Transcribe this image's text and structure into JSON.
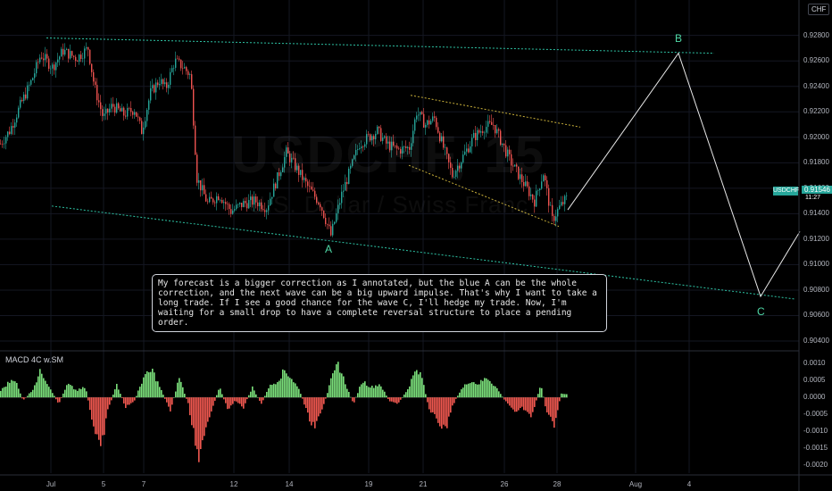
{
  "currency": "CHF",
  "symbol": "USDCHF",
  "watermark": {
    "title": "USDCHF, 15",
    "subtitle": "U.S. Dollar / Swiss Franc"
  },
  "annotation": "My forecast is a bigger correction as I annotated, but the blue A can be the whole correction, and the next wave can be a big upward impulse. That's why I want to take a long trade. If I see a good chance for the wave C, I'll hedge my trade. Now, I'm waiting for a small drop to have a complete reversal structure to place a pending order.",
  "wave_labels": {
    "a": "A",
    "b": "B",
    "c": "C"
  },
  "current_price": {
    "value": "0.91546",
    "time": "11:27",
    "symbol": "USDCHF"
  },
  "macd_label": "MACD 4C w.SM",
  "colors": {
    "up": "#26a69a",
    "down": "#ef5350",
    "hist_up": "#7be07b",
    "hist_down": "#f0584f",
    "teal_line": "#2ec4a5",
    "yellow_line": "#c9b03a",
    "projection": "#e8e8e8"
  },
  "chart_data": [
    {
      "type": "candlestick",
      "y_ticks": [
        "0.92800",
        "0.92600",
        "0.92400",
        "0.92200",
        "0.92000",
        "0.91800",
        "0.91600",
        "0.91400",
        "0.91200",
        "0.91000",
        "0.90800",
        "0.90600",
        "0.90400"
      ],
      "ylim": [
        0.9033,
        0.9298
      ],
      "x_ticks": [
        "Jul",
        "5",
        "7",
        "12",
        "14",
        "19",
        "21",
        "26",
        "28",
        "Aug",
        "4"
      ],
      "price_path": [
        [
          0,
          0.9195
        ],
        [
          10,
          0.9205
        ],
        [
          22,
          0.9225
        ],
        [
          35,
          0.9245
        ],
        [
          45,
          0.9265
        ],
        [
          58,
          0.9255
        ],
        [
          70,
          0.9268
        ],
        [
          85,
          0.9262
        ],
        [
          98,
          0.927
        ],
        [
          105,
          0.924
        ],
        [
          115,
          0.9215
        ],
        [
          125,
          0.9225
        ],
        [
          138,
          0.9218
        ],
        [
          150,
          0.9222
        ],
        [
          158,
          0.9205
        ],
        [
          168,
          0.9235
        ],
        [
          178,
          0.9245
        ],
        [
          185,
          0.9238
        ],
        [
          195,
          0.926
        ],
        [
          205,
          0.9255
        ],
        [
          213,
          0.9248
        ],
        [
          220,
          0.9168
        ],
        [
          232,
          0.9148
        ],
        [
          245,
          0.9155
        ],
        [
          258,
          0.9142
        ],
        [
          272,
          0.9148
        ],
        [
          285,
          0.915
        ],
        [
          298,
          0.9145
        ],
        [
          310,
          0.9168
        ],
        [
          320,
          0.9188
        ],
        [
          332,
          0.9175
        ],
        [
          345,
          0.916
        ],
        [
          358,
          0.9148
        ],
        [
          370,
          0.9123
        ],
        [
          382,
          0.9155
        ],
        [
          392,
          0.9175
        ],
        [
          402,
          0.9195
        ],
        [
          412,
          0.92
        ],
        [
          422,
          0.9205
        ],
        [
          432,
          0.9195
        ],
        [
          445,
          0.919
        ],
        [
          458,
          0.9192
        ],
        [
          466,
          0.922
        ],
        [
          476,
          0.921
        ],
        [
          486,
          0.9215
        ],
        [
          496,
          0.9192
        ],
        [
          506,
          0.917
        ],
        [
          518,
          0.9185
        ],
        [
          530,
          0.92
        ],
        [
          542,
          0.9208
        ],
        [
          552,
          0.921
        ],
        [
          562,
          0.9195
        ],
        [
          572,
          0.918
        ],
        [
          585,
          0.9165
        ],
        [
          598,
          0.915
        ],
        [
          608,
          0.9172
        ],
        [
          618,
          0.9135
        ],
        [
          626,
          0.9145
        ],
        [
          634,
          0.9152
        ]
      ],
      "channel_upper": [
        [
          52,
          0.9278
        ],
        [
          800,
          0.9266
        ]
      ],
      "channel_lower": [
        [
          58,
          0.9146
        ],
        [
          890,
          0.9073
        ]
      ],
      "yellow_upper": [
        [
          460,
          0.9233
        ],
        [
          650,
          0.9208
        ]
      ],
      "yellow_lower": [
        [
          458,
          0.9178
        ],
        [
          626,
          0.913
        ]
      ],
      "projection": [
        [
          636,
          0.9143
        ],
        [
          760,
          0.9266
        ],
        [
          852,
          0.9075
        ],
        [
          896,
          0.9126
        ]
      ],
      "wave_points": {
        "A": [
          368,
          0.9112
        ],
        "B": [
          760,
          0.9278
        ],
        "C": [
          852,
          0.9063
        ]
      }
    },
    {
      "type": "bar",
      "name": "MACD 4C w.SM",
      "y_ticks": [
        "0.0010",
        "0.0005",
        "0.0000",
        "-0.0005",
        "-0.0010",
        "-0.0015",
        "-0.0020"
      ],
      "ylim": [
        -0.00225,
        0.00125
      ],
      "histogram": [
        [
          0,
          0.0002
        ],
        [
          15,
          0.0006
        ],
        [
          25,
          -0.0001
        ],
        [
          35,
          0.0002
        ],
        [
          45,
          0.0008
        ],
        [
          55,
          0.0003
        ],
        [
          65,
          -0.0002
        ],
        [
          75,
          0.0004
        ],
        [
          85,
          0.0002
        ],
        [
          95,
          0.0003
        ],
        [
          105,
          -0.001
        ],
        [
          112,
          -0.0016
        ],
        [
          120,
          -0.0004
        ],
        [
          130,
          0.0004
        ],
        [
          140,
          -0.0003
        ],
        [
          150,
          -0.0001
        ],
        [
          160,
          0.0006
        ],
        [
          170,
          0.0008
        ],
        [
          180,
          0.0002
        ],
        [
          190,
          -0.0004
        ],
        [
          200,
          0.0006
        ],
        [
          210,
          -0.0002
        ],
        [
          217,
          -0.0012
        ],
        [
          222,
          -0.0021
        ],
        [
          228,
          -0.001
        ],
        [
          236,
          -0.0004
        ],
        [
          245,
          0.0003
        ],
        [
          255,
          -0.0004
        ],
        [
          262,
          -0.0001
        ],
        [
          272,
          -0.0003
        ],
        [
          282,
          0.0003
        ],
        [
          292,
          -0.0002
        ],
        [
          300,
          0.0003
        ],
        [
          310,
          0.0005
        ],
        [
          318,
          0.0008
        ],
        [
          325,
          0.0006
        ],
        [
          335,
          0.0002
        ],
        [
          345,
          -0.0006
        ],
        [
          352,
          -0.0009
        ],
        [
          360,
          -0.0004
        ],
        [
          370,
          0.0005
        ],
        [
          378,
          0.001
        ],
        [
          385,
          0.0005
        ],
        [
          395,
          -0.0002
        ],
        [
          405,
          0.0005
        ],
        [
          415,
          0.0003
        ],
        [
          425,
          0.0004
        ],
        [
          435,
          -0.0001
        ],
        [
          445,
          -0.0002
        ],
        [
          455,
          0.0002
        ],
        [
          465,
          0.0008
        ],
        [
          472,
          0.0006
        ],
        [
          480,
          -0.0004
        ],
        [
          490,
          -0.0007
        ],
        [
          498,
          -0.001
        ],
        [
          505,
          -0.0003
        ],
        [
          515,
          0.0002
        ],
        [
          525,
          0.0005
        ],
        [
          535,
          0.0004
        ],
        [
          545,
          0.0006
        ],
        [
          555,
          0.0003
        ],
        [
          565,
          -0.0001
        ],
        [
          575,
          -0.0004
        ],
        [
          585,
          -0.0003
        ],
        [
          595,
          -0.0006
        ],
        [
          605,
          0.0004
        ],
        [
          612,
          -0.0005
        ],
        [
          620,
          -0.0008
        ],
        [
          628,
          0.0001
        ],
        [
          634,
          0.0001
        ]
      ]
    }
  ]
}
